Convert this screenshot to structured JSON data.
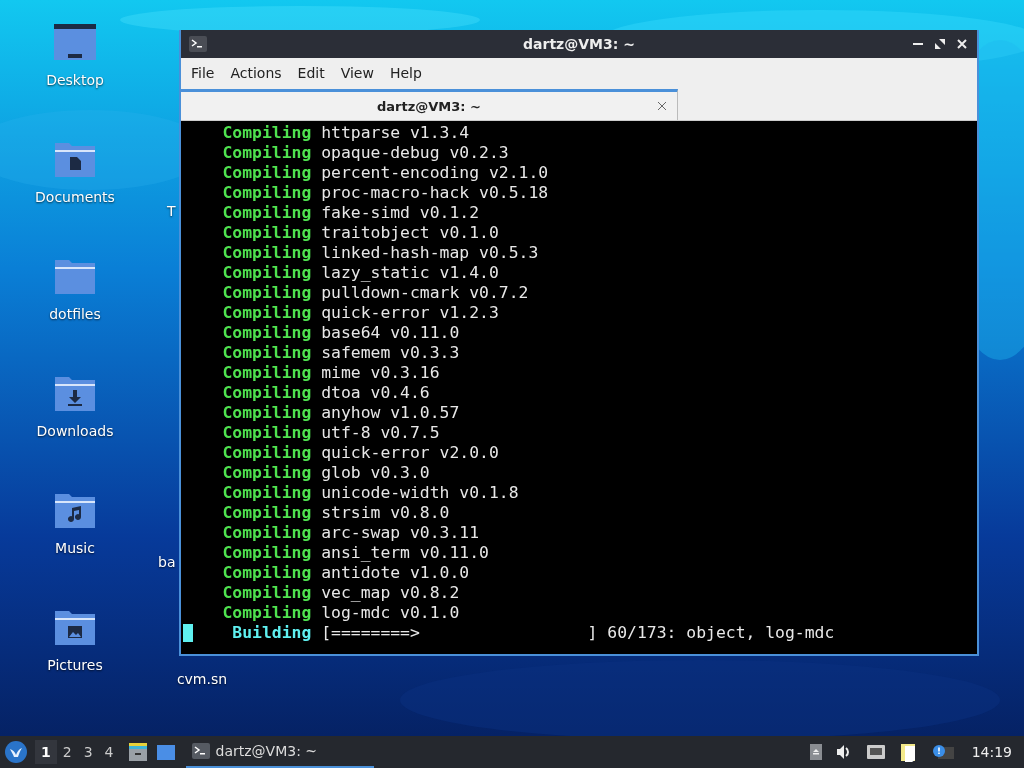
{
  "desktop": {
    "icons": [
      {
        "label": "Desktop",
        "kind": "desktop"
      },
      {
        "label": "Documents",
        "kind": "documents"
      },
      {
        "label": "dotfiles",
        "kind": "folder"
      },
      {
        "label": "Downloads",
        "kind": "downloads"
      },
      {
        "label": "Music",
        "kind": "music"
      },
      {
        "label": "Pictures",
        "kind": "pictures"
      }
    ],
    "partial_labels": [
      {
        "label": "T"
      },
      {
        "label": "ba"
      },
      {
        "label": "cvm.sn"
      }
    ]
  },
  "window": {
    "title": "dartz@VM3: ~",
    "menu": [
      "File",
      "Actions",
      "Edit",
      "View",
      "Help"
    ],
    "tabs": [
      {
        "label": "dartz@VM3: ~",
        "selected": true
      }
    ],
    "terminal": {
      "cursor": true,
      "lines": [
        {
          "kind": "compiling",
          "verb": "Compiling",
          "text": "httparse v1.3.4"
        },
        {
          "kind": "compiling",
          "verb": "Compiling",
          "text": "opaque-debug v0.2.3"
        },
        {
          "kind": "compiling",
          "verb": "Compiling",
          "text": "percent-encoding v2.1.0"
        },
        {
          "kind": "compiling",
          "verb": "Compiling",
          "text": "proc-macro-hack v0.5.18"
        },
        {
          "kind": "compiling",
          "verb": "Compiling",
          "text": "fake-simd v0.1.2"
        },
        {
          "kind": "compiling",
          "verb": "Compiling",
          "text": "traitobject v0.1.0"
        },
        {
          "kind": "compiling",
          "verb": "Compiling",
          "text": "linked-hash-map v0.5.3"
        },
        {
          "kind": "compiling",
          "verb": "Compiling",
          "text": "lazy_static v1.4.0"
        },
        {
          "kind": "compiling",
          "verb": "Compiling",
          "text": "pulldown-cmark v0.7.2"
        },
        {
          "kind": "compiling",
          "verb": "Compiling",
          "text": "quick-error v1.2.3"
        },
        {
          "kind": "compiling",
          "verb": "Compiling",
          "text": "base64 v0.11.0"
        },
        {
          "kind": "compiling",
          "verb": "Compiling",
          "text": "safemem v0.3.3"
        },
        {
          "kind": "compiling",
          "verb": "Compiling",
          "text": "mime v0.3.16"
        },
        {
          "kind": "compiling",
          "verb": "Compiling",
          "text": "dtoa v0.4.6"
        },
        {
          "kind": "compiling",
          "verb": "Compiling",
          "text": "anyhow v1.0.57"
        },
        {
          "kind": "compiling",
          "verb": "Compiling",
          "text": "utf-8 v0.7.5"
        },
        {
          "kind": "compiling",
          "verb": "Compiling",
          "text": "quick-error v2.0.0"
        },
        {
          "kind": "compiling",
          "verb": "Compiling",
          "text": "glob v0.3.0"
        },
        {
          "kind": "compiling",
          "verb": "Compiling",
          "text": "unicode-width v0.1.8"
        },
        {
          "kind": "compiling",
          "verb": "Compiling",
          "text": "strsim v0.8.0"
        },
        {
          "kind": "compiling",
          "verb": "Compiling",
          "text": "arc-swap v0.3.11"
        },
        {
          "kind": "compiling",
          "verb": "Compiling",
          "text": "ansi_term v0.11.0"
        },
        {
          "kind": "compiling",
          "verb": "Compiling",
          "text": "antidote v1.0.0"
        },
        {
          "kind": "compiling",
          "verb": "Compiling",
          "text": "vec_map v0.8.2"
        },
        {
          "kind": "compiling",
          "verb": "Compiling",
          "text": "log-mdc v0.1.0"
        },
        {
          "kind": "building",
          "verb": "Building",
          "text": "[========>                 ] 60/173: object, log-mdc"
        }
      ]
    }
  },
  "taskbar": {
    "workspaces": [
      {
        "label": "1",
        "selected": true
      },
      {
        "label": "2",
        "selected": false
      },
      {
        "label": "3",
        "selected": false
      },
      {
        "label": "4",
        "selected": false
      }
    ],
    "tasks": [
      {
        "label": "dartz@VM3: ~",
        "selected": true
      }
    ],
    "clock": "14:19"
  }
}
